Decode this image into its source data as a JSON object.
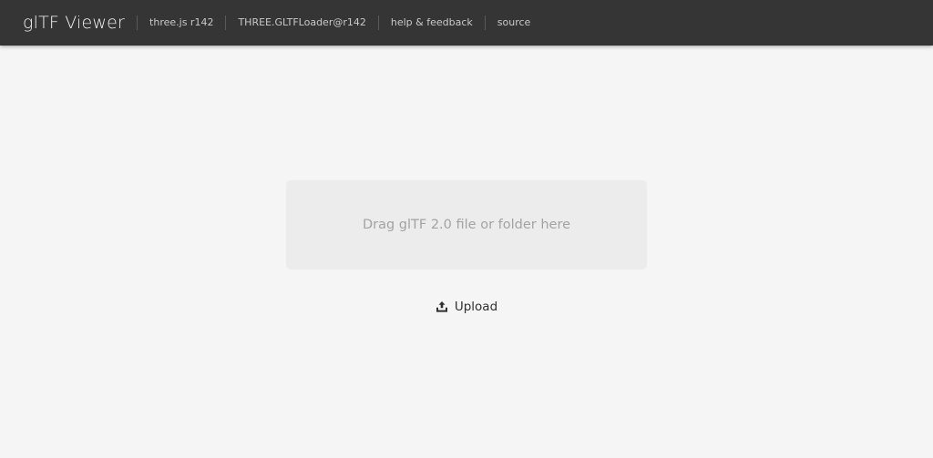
{
  "header": {
    "title": "glTF Viewer",
    "links": [
      "three.js r142",
      "THREE.GLTFLoader@r142",
      "help & feedback",
      "source"
    ]
  },
  "dropzone": {
    "text": "Drag glTF 2.0 file or folder here"
  },
  "upload": {
    "label": "Upload",
    "icon": "upload-icon"
  },
  "colors": {
    "header_bg": "#353535",
    "page_bg": "#f5f5f5",
    "dropzone_bg": "#ececec"
  }
}
